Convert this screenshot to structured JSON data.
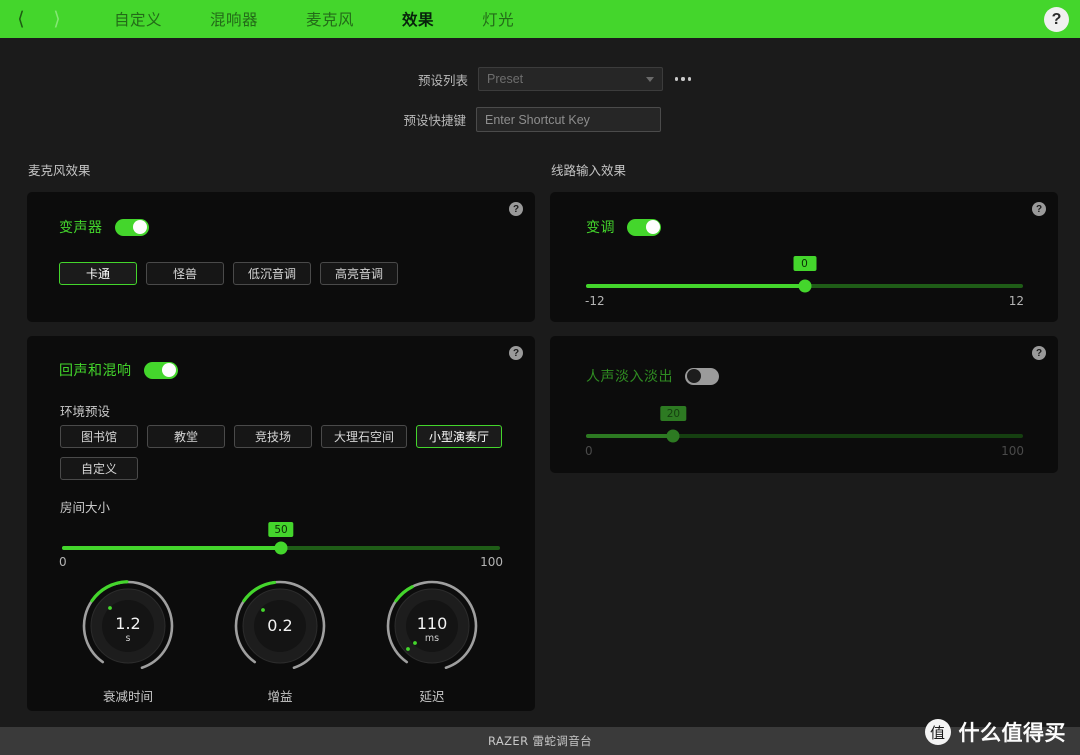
{
  "topbar": {
    "back_icon": "chevron-left-icon",
    "forward_icon": "chevron-right-icon",
    "help_icon": "?",
    "tabs": [
      {
        "label": "自定义",
        "active": false
      },
      {
        "label": "混响器",
        "active": false
      },
      {
        "label": "麦克风",
        "active": false
      },
      {
        "label": "效果",
        "active": true
      },
      {
        "label": "灯光",
        "active": false
      }
    ],
    "accent_color": "#44d62c"
  },
  "preset": {
    "list_label": "预设列表",
    "list_value": "Preset",
    "list_chevron_icon": "chevron-down-icon",
    "more_icon": "ellipsis-icon",
    "shortcut_label": "预设快捷键",
    "shortcut_placeholder": "Enter Shortcut Key",
    "shortcut_value": ""
  },
  "mic_effects": {
    "title": "麦克风效果",
    "voice_changer": {
      "name": "变声器",
      "enabled": true,
      "help_icon": "?",
      "presets": [
        {
          "label": "卡通",
          "selected": true
        },
        {
          "label": "怪兽",
          "selected": false
        },
        {
          "label": "低沉音调",
          "selected": false
        },
        {
          "label": "高亮音调",
          "selected": false
        }
      ]
    },
    "echo_reverb": {
      "name": "回声和混响",
      "enabled": true,
      "help_icon": "?",
      "env_label": "环境预设",
      "env_presets": [
        {
          "label": "图书馆",
          "selected": false
        },
        {
          "label": "教堂",
          "selected": false
        },
        {
          "label": "竞技场",
          "selected": false
        },
        {
          "label": "大理石空间",
          "selected": false
        },
        {
          "label": "小型演奏厅",
          "selected": true
        },
        {
          "label": "自定义",
          "selected": false
        }
      ],
      "room_size": {
        "label": "房间大小",
        "value": 50,
        "min": 0,
        "max": 100,
        "min_label": "0",
        "max_label": "100"
      },
      "knobs": [
        {
          "label": "衰减时间",
          "value": "1.2",
          "unit": "s",
          "percent": 22
        },
        {
          "label": "增益",
          "value": "0.2",
          "unit": "",
          "percent": 18
        },
        {
          "label": "延迟",
          "value": "110",
          "unit": "ms",
          "percent": 7
        }
      ]
    }
  },
  "line_in_effects": {
    "title": "线路输入效果",
    "pitch_shift": {
      "name": "变调",
      "enabled": true,
      "help_icon": "?",
      "value": 0,
      "min": -12,
      "max": 12,
      "min_label": "-12",
      "max_label": "12"
    },
    "voice_fade": {
      "name": "人声淡入淡出",
      "enabled": false,
      "help_icon": "?",
      "value": 20,
      "min": 0,
      "max": 100,
      "min_label": "0",
      "max_label": "100"
    }
  },
  "footer": {
    "text": "RAZER 雷蛇调音台"
  },
  "watermark": {
    "badge": "值",
    "text": "什么值得买"
  }
}
